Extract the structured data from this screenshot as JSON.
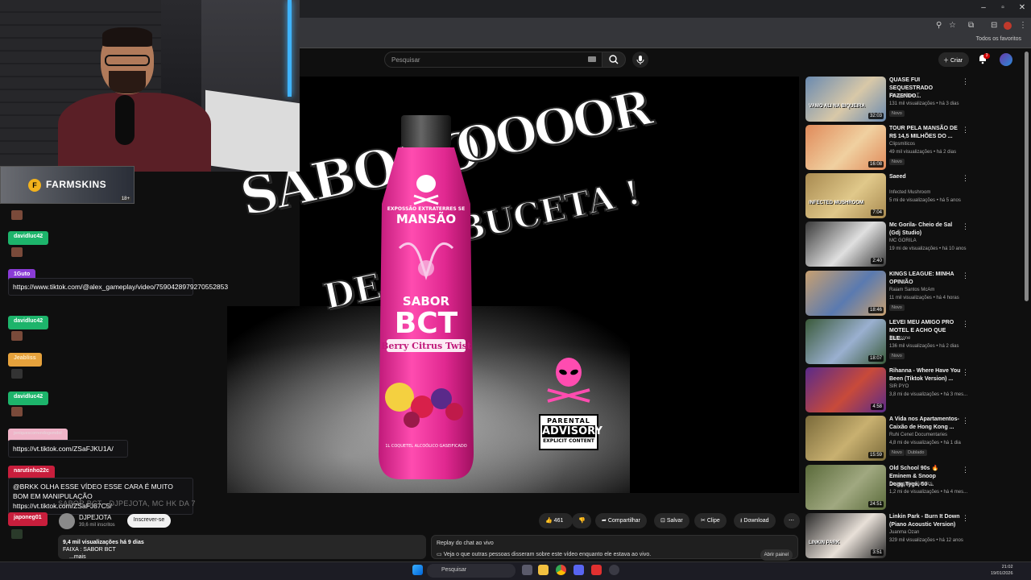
{
  "header": {
    "search_placeholder": "Pesquisar",
    "create_label": "Criar",
    "notif_count": "3",
    "bookmarks_label": "Todos os favoritos"
  },
  "video": {
    "overlay_line1": "SABOOO",
    "overlay_line2": "OOOOR",
    "overlay_line3": "DE",
    "overlay_line4": "BUCETA !",
    "bottle_top": "EXPOSSÃO EXTRATERRES SE",
    "bottle_brand": "MANSÃO",
    "bottle_sabor": "SABOR",
    "bottle_bct": "BCT",
    "bottle_flavor": "Berry Citrus Twist",
    "bottle_note": "1L COQUETEL ALCOÓLICO GASEIFICADO",
    "advisory_top": "PARENTAL",
    "advisory_mid": "ADVISORY",
    "advisory_bottom": "EXPLICIT CONTENT",
    "title_overlay": "SABOR BCT - DJPEJOTA, MC HK DA 7"
  },
  "stream": {
    "sponsor": "FARMSKINS",
    "age": "18+"
  },
  "chat": [
    {
      "user": "davidluc42",
      "color": "#1db46b"
    },
    {
      "user": "1Guto",
      "color": "#8a3bd6",
      "message": "https://www.tiktok.com/@alex_gameplay/video/7590428979270552853"
    },
    {
      "user": "davidluc42",
      "color": "#1db46b"
    },
    {
      "user": "Jeabliss",
      "color": "#e6a23c"
    },
    {
      "user": "davidluc42",
      "color": "#1db46b"
    },
    {
      "user": "jeniquescorrendogemdol",
      "color": "#f0b4c8",
      "message": "https://vt.tiktok.com/ZSaFJKU1A/"
    },
    {
      "user": "narutinho22c",
      "color": "#c81e3c",
      "message": "@BRKK OLHA ESSE VÍDEO ESSE CARA É MUITO BOM EM MANIPULAÇÃO https://vt.tiktok.com/ZSaFJ87C5/"
    },
    {
      "user": "japoneg01",
      "color": "#c81e3c"
    }
  ],
  "channel": {
    "name": "DJPEJOTA",
    "subs": "39,6 mil inscritos",
    "subscribe": "Inscrever-se"
  },
  "actions": {
    "likes": "461",
    "share": "Compartilhar",
    "save": "Salvar",
    "clip": "Clipe",
    "download": "Download"
  },
  "description": {
    "stats": "9,4 mil visualizações  há 9 dias",
    "line2": "FAIXA : SABOR BCT",
    "more": "...mais"
  },
  "replay": {
    "title": "Replay do chat ao vivo",
    "text": "Veja o que outras pessoas disseram sobre este vídeo enquanto ele estava ao vivo.",
    "button": "Abrir painel"
  },
  "recommendations": [
    {
      "title": "QUASE FUI SEQUESTRADO FAZENDO...",
      "channel": "Thiago Sem T",
      "stats": "131 mil visualizações • há 3 dias",
      "badge": "Novo",
      "duration": "32:03",
      "thumb_caption": "VAMO ALI NA BIQUEIRA",
      "c1": "#6a8ab0",
      "c2": "#d8c8a8"
    },
    {
      "title": "TOUR PELA MANSÃO DE R$ 14,5 MILHÕES DO ...",
      "channel": "Clipsmiticos",
      "stats": "49 mil visualizações • há 2 dias",
      "badge": "Novo",
      "duration": "16:08",
      "thumb_caption": "",
      "c1": "#e08a5a",
      "c2": "#f0d0a0"
    },
    {
      "title": "Saeed",
      "channel": "Infected Mushroom",
      "stats": "5 mi de visualizações • há 5 anos",
      "badge": "",
      "duration": "7:04",
      "thumb_caption": "INFECTED MUSHROOM",
      "c1": "#a88a50",
      "c2": "#e0c88a"
    },
    {
      "title": "Mc Gorila- Cheio de Sal (Gdj Studio)",
      "channel": "MC GORILA",
      "stats": "19 mi de visualizações • há 10 anos",
      "badge": "",
      "duration": "2:40",
      "thumb_caption": "",
      "c1": "#3a3a3a",
      "c2": "#e0e0e0"
    },
    {
      "title": "KINGS LEAGUE: MINHA OPINIÃO",
      "channel": "Raiam Santos McAm",
      "stats": "11 mil visualizações • há 4 horas",
      "badge": "Novo",
      "duration": "18:46",
      "thumb_caption": "",
      "c1": "#c8a070",
      "c2": "#5a7ab0"
    },
    {
      "title": "LEVEI MEU AMIGO PRO MOTEL E ACHO QUE ELE...",
      "channel": "Bistecone",
      "stats": "136 mil visualizações • há 2 dias",
      "badge": "Novo",
      "duration": "18:07",
      "thumb_caption": "",
      "c1": "#3a5a3a",
      "c2": "#9ab0d0"
    },
    {
      "title": "Rihanna - Where Have You Been (Tiktok Version) ...",
      "channel": "SIR PYO",
      "stats": "3,8 mi de visualizações • há 3 mes...",
      "badge": "",
      "duration": "4:58",
      "thumb_caption": "",
      "c1": "#5a2a8a",
      "c2": "#c84a3a"
    },
    {
      "title": "A Vida nos Apartamentos-Caixão de Hong Kong ...",
      "channel": "Ruhi Cenet Documentaries",
      "stats": "4,8 mi de visualizações • há 1 dia",
      "badge": "Novo",
      "badge2": "Dublado",
      "duration": "15:59",
      "thumb_caption": "",
      "c1": "#7a6a3a",
      "c2": "#c8b070"
    },
    {
      "title": "Old School 90s 🔥 Eminem & Snoop Dogg,Tyga, 50 ...",
      "channel": "Doggystyle Classics",
      "stats": "1,2 mi de visualizações • há 4 mes...",
      "badge": "",
      "duration": "24:51",
      "thumb_caption": "",
      "c1": "#5a6a3a",
      "c2": "#a0a880"
    },
    {
      "title": "Linkin Park - Burn It Down (Piano Acoustic Version)",
      "channel": "Juanma Ozan",
      "stats": "329 mil visualizações • há 12 anos",
      "badge": "",
      "duration": "3:51",
      "thumb_caption": "LINKIN PARK",
      "c1": "#2a2a2a",
      "c2": "#e8e0d8"
    }
  ],
  "taskbar": {
    "search": "Pesquisar",
    "time": "21:02",
    "date": "19/01/2026"
  }
}
